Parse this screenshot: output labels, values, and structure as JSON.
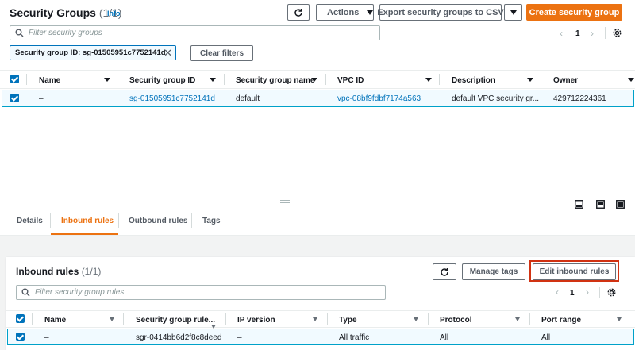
{
  "top": {
    "title": "Security Groups",
    "count": "(1/1)",
    "info": "Info",
    "actions_label": "Actions",
    "export_label": "Export security groups to CSV",
    "create_label": "Create security group",
    "search_placeholder": "Filter security groups",
    "page": "1",
    "filter_token": "Security group ID: sg-01505951c7752141d",
    "clear_filters": "Clear filters",
    "columns": [
      "Name",
      "Security group ID",
      "Security group name",
      "VPC ID",
      "Description",
      "Owner"
    ],
    "row": {
      "name": "–",
      "id": "sg-01505951c7752141d",
      "group_name": "default",
      "vpc": "vpc-08bf9fdbf7174a563",
      "description": "default VPC security gr...",
      "owner": "429712224361"
    }
  },
  "tabs": [
    "Details",
    "Inbound rules",
    "Outbound rules",
    "Tags"
  ],
  "inbound": {
    "title": "Inbound rules",
    "count": "(1/1)",
    "manage_tags": "Manage tags",
    "edit_label": "Edit inbound rules",
    "search_placeholder": "Filter security group rules",
    "page": "1",
    "columns": [
      "Name",
      "Security group rule...",
      "IP version",
      "Type",
      "Protocol",
      "Port range"
    ],
    "row": {
      "name": "–",
      "rule_id": "sgr-0414bb6d2f8c8deed",
      "ip_version": "–",
      "type": "All traffic",
      "protocol": "All",
      "port_range": "All"
    }
  },
  "colors": {
    "accent": "#ec7211",
    "link": "#0073bb",
    "selected_row": "#f1faff",
    "highlight_box": "#d13212"
  }
}
